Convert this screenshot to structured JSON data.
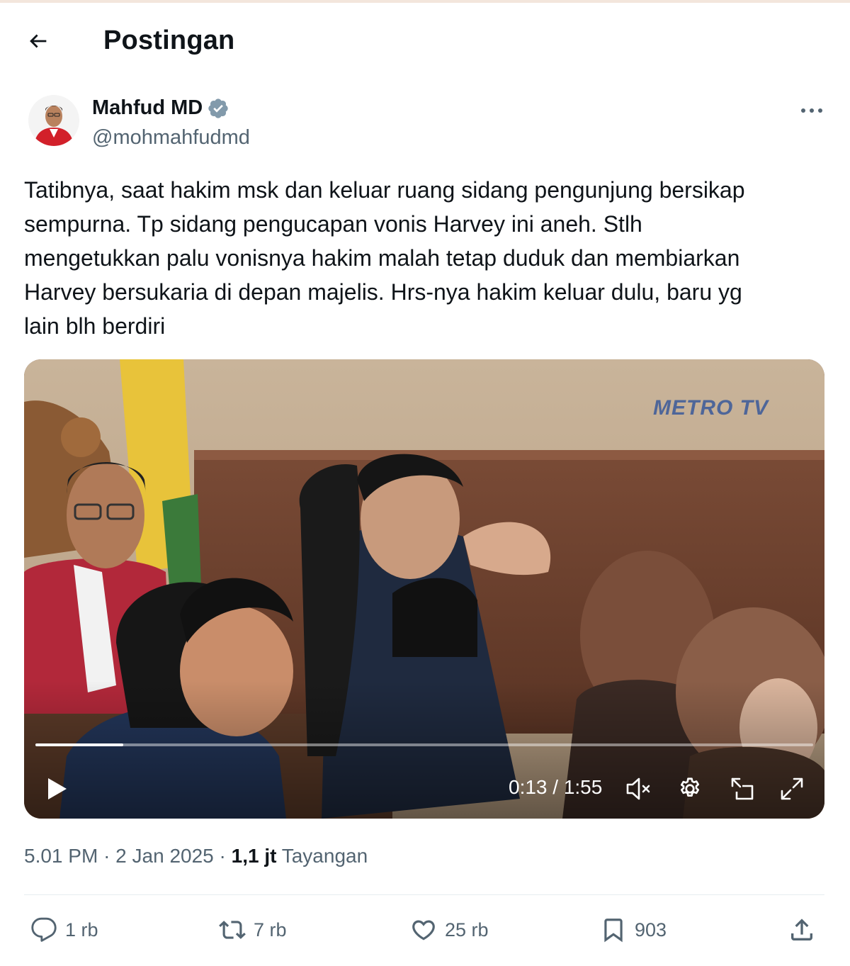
{
  "header": {
    "title": "Postingan"
  },
  "author": {
    "name": "Mahfud MD",
    "handle": "@mohmahfudmd"
  },
  "tweet": {
    "text": "Tatibnya, saat hakim msk dan keluar ruang sidang pengunjung bersikap\nsempurna. Tp sidang pengucapan vonis Harvey ini aneh. Stlh\nmengetukkan palu vonisnya hakim malah tetap duduk dan membiarkan\nHarvey bersukaria di depan majelis. Hrs-nya hakim keluar dulu, baru yg\nlain blh berdiri"
  },
  "video": {
    "watermark": "METRO TV",
    "time": "0:13 / 1:55",
    "progress": 0.113
  },
  "meta": {
    "time": "5.01 PM",
    "date": "2 Jan 2025",
    "views_count": "1,1 jt",
    "views_label": "Tayangan"
  },
  "actions": {
    "replies": "1 rb",
    "reposts": "7 rb",
    "likes": "25 rb",
    "bookmarks": "903"
  },
  "colors": {
    "text": "#0f1419",
    "secondary": "#536471",
    "verified": "#829aab"
  }
}
